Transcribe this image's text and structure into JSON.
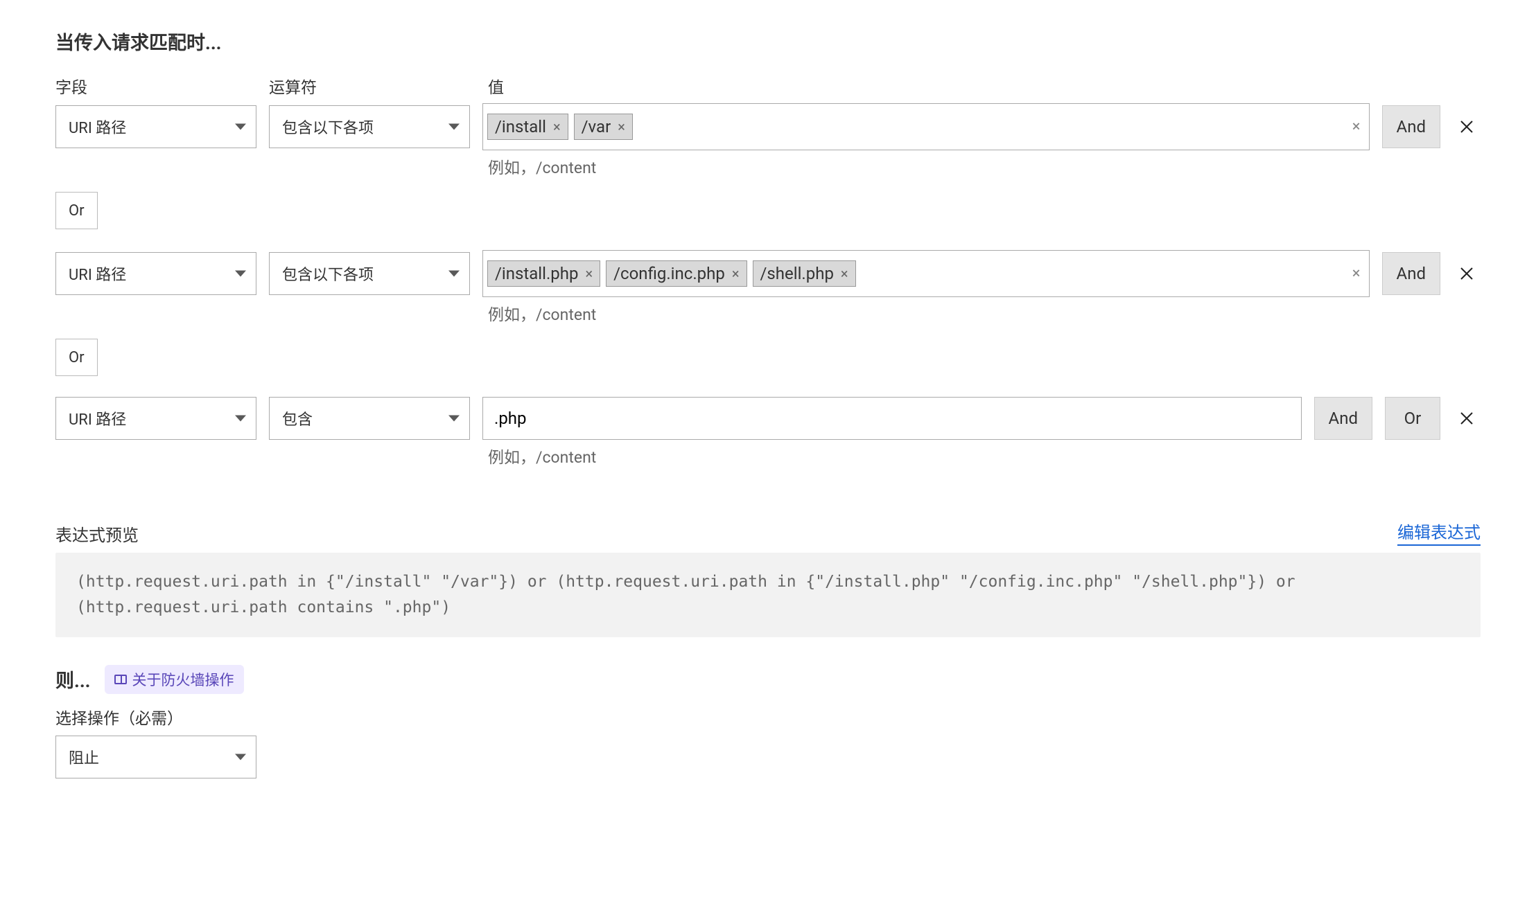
{
  "section_title": "当传入请求匹配时...",
  "labels": {
    "field": "字段",
    "operator": "运算符",
    "value": "值"
  },
  "hint": "例如，/content",
  "and": "And",
  "or": "Or",
  "rows": [
    {
      "field": "URI 路径",
      "operator": "包含以下各项",
      "type": "tags",
      "tags": [
        "/install",
        "/var"
      ],
      "trailing": [
        "and"
      ]
    },
    {
      "field": "URI 路径",
      "operator": "包含以下各项",
      "type": "tags",
      "tags": [
        "/install.php",
        "/config.inc.php",
        "/shell.php"
      ],
      "trailing": [
        "and"
      ]
    },
    {
      "field": "URI 路径",
      "operator": "包含",
      "type": "text",
      "value": ".php",
      "trailing": [
        "and",
        "or"
      ]
    }
  ],
  "preview": {
    "title": "表达式预览",
    "edit": "编辑表达式",
    "expression": "(http.request.uri.path in {\"/install\" \"/var\"}) or (http.request.uri.path in {\"/install.php\" \"/config.inc.php\" \"/shell.php\"}) or (http.request.uri.path contains \".php\")"
  },
  "then": {
    "label": "则...",
    "about": "关于防火墙操作",
    "select_label": "选择操作（必需）",
    "action": "阻止"
  }
}
